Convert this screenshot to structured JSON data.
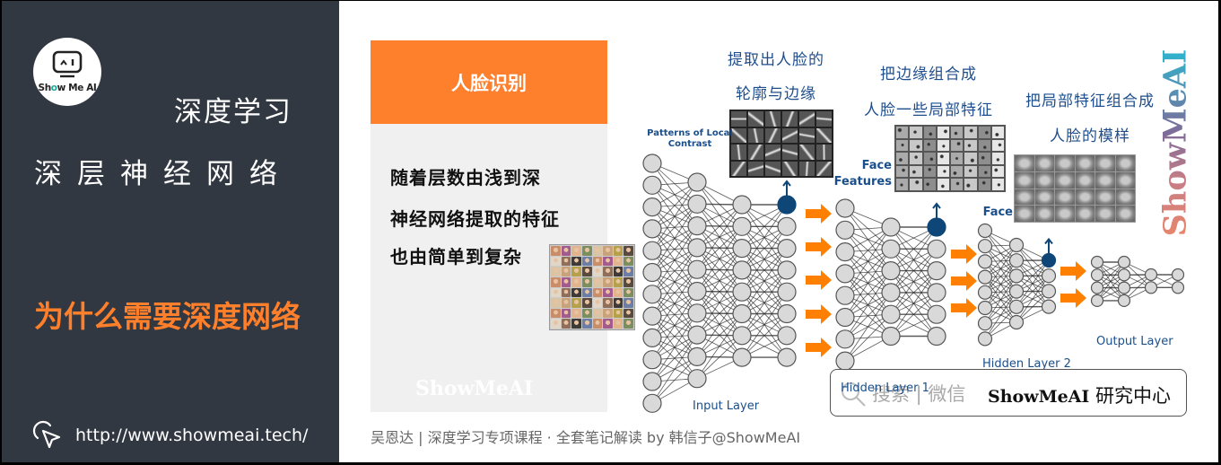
{
  "sidebar": {
    "logo_text_prefix": "Sh",
    "logo_text_o": "o",
    "logo_text_suffix": "w Me AI",
    "subtitle": "深度学习",
    "title": "深层神经网络",
    "section_title": "为什么需要深度网络",
    "url": "http://www.showmeai.tech/",
    "url_icon": "cursor-click-icon"
  },
  "card": {
    "header": "人脸识别",
    "lines": [
      "随着层数由浅到深",
      "神经网络提取的特征",
      "也由简单到复杂"
    ],
    "watermark": "ShowMeAI"
  },
  "diagram": {
    "annotations": {
      "edges": [
        "提取出人脸的",
        "轮廓与边缘"
      ],
      "parts": [
        "把边缘组合成",
        "人脸一些局部特征"
      ],
      "faces": [
        "把局部特征组合成",
        "人脸的模样"
      ]
    },
    "labels": {
      "patterns": [
        "Patterns of Local",
        "Contrast"
      ],
      "face_features": [
        "Face",
        "Features"
      ],
      "face": "Face",
      "input_layer": "Input Layer",
      "hidden_layer_1": "Hidden Layer 1",
      "hidden_layer_2": "Hidden Layer 2",
      "output_layer": "Output Layer"
    },
    "networks": [
      {
        "name": "network-1",
        "layers": [
          12,
          10,
          8,
          8
        ],
        "highlight_layer": 3,
        "highlight_node": 0
      },
      {
        "name": "network-2",
        "layers": [
          8,
          6,
          6
        ],
        "highlight_layer": 2,
        "highlight_node": 0
      },
      {
        "name": "network-3",
        "layers": [
          8,
          6,
          4
        ],
        "highlight_layer": 2,
        "highlight_node": 0
      },
      {
        "name": "network-4",
        "layers": [
          4,
          4,
          2,
          2
        ],
        "highlight_layer": -1,
        "highlight_node": -1
      }
    ],
    "colors": {
      "node_fill": "#d9d9d9",
      "node_stroke": "#555555",
      "highlight": "#0e4678",
      "arrow": "#ff8000",
      "edge": "#222222"
    }
  },
  "vertical_watermark": "ShowMeAI",
  "search_box": {
    "hint": "搜索 | 微信",
    "brand_latin": "ShowMeAI",
    "brand_cn": " 研究中心"
  },
  "footer": "吴恩达 | 深度学习专项课程 · 全套笔记解读  by 韩信子@ShowMeAI",
  "colors": {
    "sidebar_bg": "#323842",
    "accent_orange": "#fe7f2c",
    "annotation_blue": "#1f4e8c"
  }
}
